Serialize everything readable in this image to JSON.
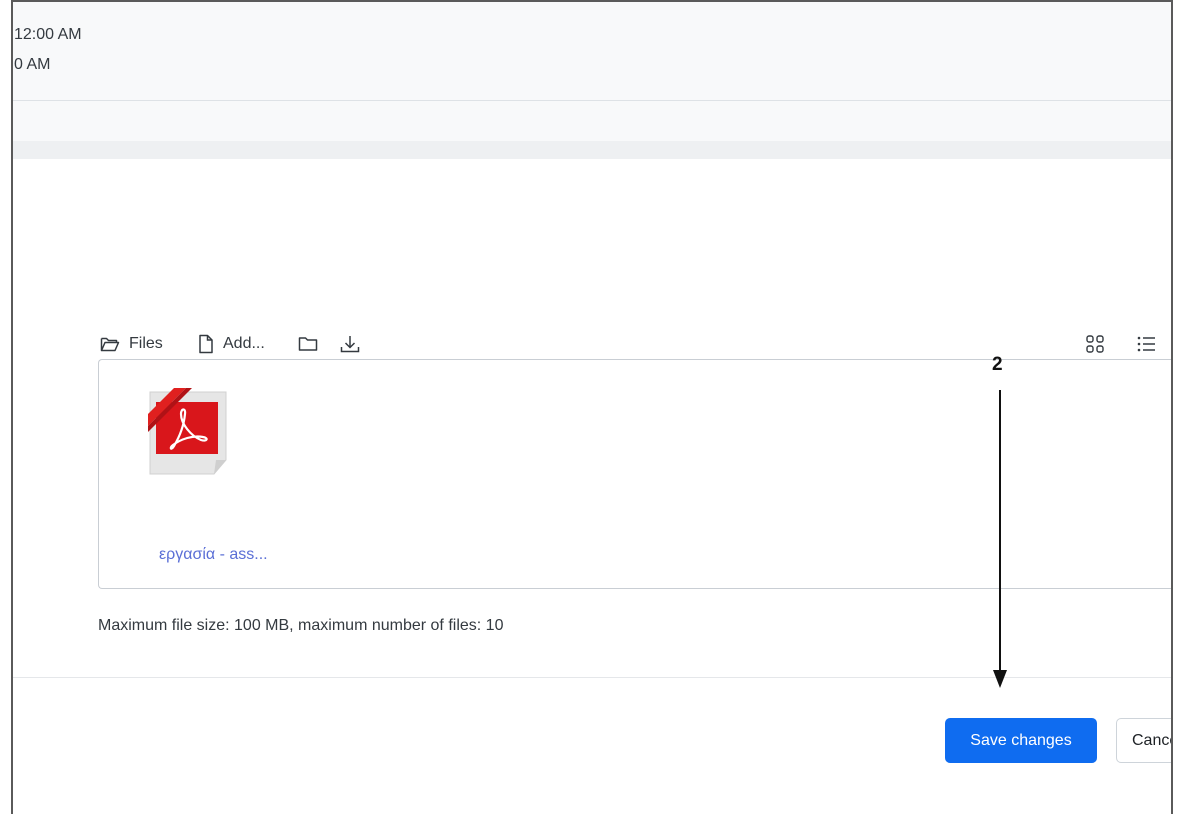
{
  "dates": {
    "line1": "12:00 AM",
    "line2": "0 AM"
  },
  "filemanager": {
    "toolbar": {
      "files_label": "Files",
      "add_label": "Add...",
      "icons": [
        "folder-open-icon",
        "file-icon",
        "folder-icon",
        "download-icon",
        "grid-view-icon",
        "list-view-icon"
      ]
    },
    "files": [
      {
        "name": "εργασία - ass...",
        "icon": "pdf-file-icon"
      }
    ],
    "limits": "Maximum file size: 100 MB, maximum number of files: 10"
  },
  "annotation": {
    "number": "2"
  },
  "actions": {
    "save_label": "Save changes",
    "cancel_label": "Cancel"
  },
  "colors": {
    "primary": "#0f6cf0",
    "link": "#5b6fd6",
    "panel_bg": "#f8f9fa",
    "pdf_red": "#d9161b"
  }
}
